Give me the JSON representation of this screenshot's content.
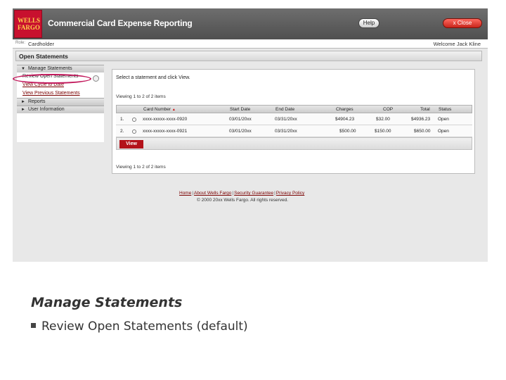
{
  "header": {
    "logo_line1": "WELLS",
    "logo_line2": "FARGO",
    "app_title": "Commercial Card Expense Reporting",
    "help_label": "Help",
    "close_label": "x  Close"
  },
  "rolebar": {
    "role_label": "Role:",
    "role_value": "Cardholder",
    "welcome": "Welcome Jack Kline"
  },
  "page_title": "Open Statements",
  "nav": {
    "manage_label": "Manage Statements",
    "items": [
      {
        "label": "Review Open Statements"
      },
      {
        "label": "View Cycle to Date"
      },
      {
        "label": "View Previous Statements"
      }
    ],
    "reports_label": "Reports",
    "userinfo_label": "User Information"
  },
  "content": {
    "instruction": "Select a statement and click View.",
    "viewing_top": "Viewing 1 to 2 of 2 items",
    "viewing_bottom": "Viewing 1 to 2 of 2 items",
    "columns": {
      "card": "Card Number",
      "start": "Start Date",
      "end": "End Date",
      "charges": "Charges",
      "cop": "COP",
      "total": "Total",
      "status": "Status"
    },
    "rows": [
      {
        "num": "1.",
        "card": "xxxx-xxxxx-xxxx-0920",
        "start": "03/01/20xx",
        "end": "03/31/20xx",
        "charges": "$4904.23",
        "cop": "$32.00",
        "total": "$4936.23",
        "status": "Open"
      },
      {
        "num": "2.",
        "card": "xxxx-xxxxx-xxxx-0921",
        "start": "03/01/20xx",
        "end": "03/31/20xx",
        "charges": "$500.00",
        "cop": "$150.00",
        "total": "$650.00",
        "status": "Open"
      }
    ],
    "view_button": "View"
  },
  "footer": {
    "links": [
      "Home",
      "About Wells Fargo",
      "Security Guarantee",
      "Privacy Policy"
    ],
    "copyright": "© 2000 20xx Wells Fargo. All rights reserved."
  },
  "slide": {
    "title": "Manage Statements",
    "bullet": "Review Open Statements (default)"
  }
}
